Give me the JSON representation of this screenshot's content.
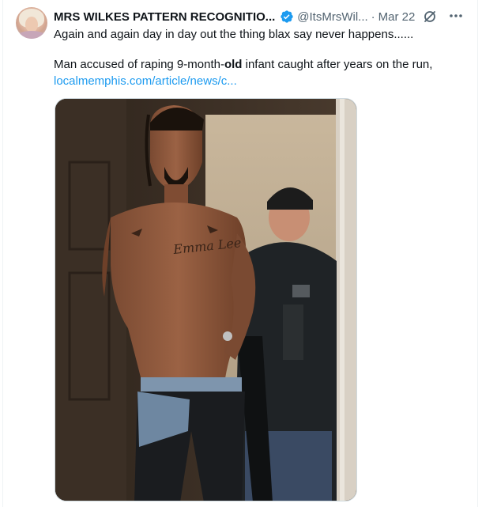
{
  "tweet": {
    "display_name": "MRS WILKES PATTERN RECOGNITIO...",
    "handle": "@ItsMrsWil...",
    "separator": "·",
    "date": "Mar 22",
    "text_line1": "Again and again  day in day out the thing  blax say never happens......",
    "text_line2_before": "Man accused of raping 9-month-",
    "text_line2_bold": "old",
    "text_line2_after": " infant caught after years on the run,",
    "link": "localmemphis.com/article/news/c...",
    "media_alt": "Photo of a shirtless man being escorted out of a doorway by a police officer"
  },
  "icons": {
    "verified": "verified-badge-icon",
    "grok": "grok-icon",
    "more": "more-options-icon"
  },
  "colors": {
    "verified_blue": "#1d9bf0",
    "link_blue": "#1d9bf0",
    "secondary_text": "#536471",
    "primary_text": "#0f1419"
  }
}
